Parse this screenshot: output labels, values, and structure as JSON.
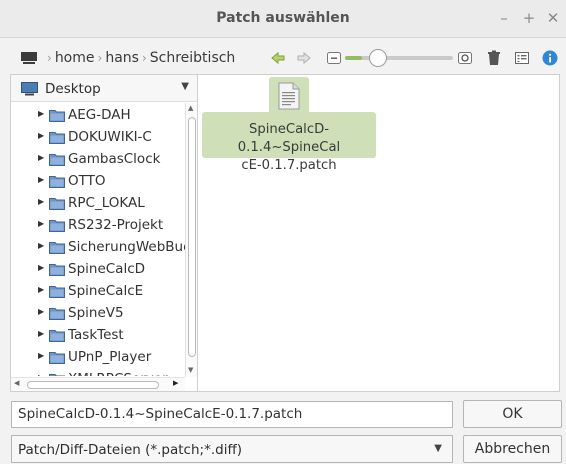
{
  "window": {
    "title": "Patch auswählen",
    "controls": [
      "–",
      "+",
      "✕"
    ]
  },
  "location": {
    "crumbs": [
      "home",
      "hans",
      "Schreibtisch"
    ]
  },
  "toolbar": {
    "zoom_level": 0.08
  },
  "sidebar": {
    "place": "Desktop",
    "folders": [
      "AEG-DAH",
      "DOKUWIKI-C",
      "GambasClock",
      "OTTO",
      "RPC_LOKAL",
      "RS232-Projekt",
      "SicherungWebBucl",
      "SpineCalcD",
      "SpineCalcE",
      "SpineV5",
      "TaskTest",
      "UPnP_Player",
      "XMLRPCServer"
    ]
  },
  "files": [
    {
      "name_line1": "SpineCalcD-0.1.4~SpineCal",
      "name_line2": "cE-0.1.7.patch",
      "icon": "text-file-icon"
    }
  ],
  "bottom": {
    "filename": "SpineCalcD-0.1.4~SpineCalcE-0.1.7.patch",
    "ok_label": "OK",
    "filter": "Patch/Diff-Dateien (*.patch;*.diff)",
    "cancel_label": "Abbrechen"
  },
  "colors": {
    "accent": "#8fbf5f",
    "selection": "#cfe0b8",
    "folder": "#6e95c7"
  }
}
